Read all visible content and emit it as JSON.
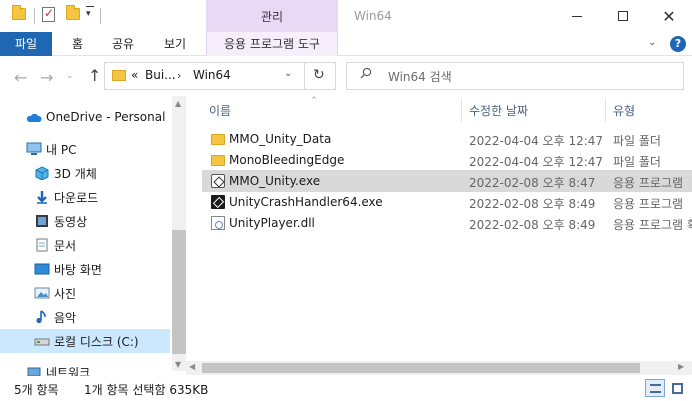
{
  "window": {
    "title": "Win64",
    "context_tab": "관리",
    "context_tools": "응용 프로그램 도구"
  },
  "ribbon": {
    "tabs": [
      "파일",
      "홈",
      "공유",
      "보기"
    ]
  },
  "address": {
    "overflow": "«",
    "crumbs": [
      "Bui...",
      "Win64"
    ]
  },
  "search": {
    "placeholder": "Win64 검색"
  },
  "sidebar": {
    "items": [
      {
        "label": "OneDrive - Personal",
        "icon": "cloud-icon"
      },
      {
        "label": "내 PC",
        "icon": "pc-icon"
      },
      {
        "label": "3D 개체",
        "icon": "3d-objects-icon"
      },
      {
        "label": "다운로드",
        "icon": "download-icon"
      },
      {
        "label": "동영상",
        "icon": "video-icon"
      },
      {
        "label": "문서",
        "icon": "document-icon"
      },
      {
        "label": "바탕 화면",
        "icon": "desktop-icon"
      },
      {
        "label": "사진",
        "icon": "picture-icon"
      },
      {
        "label": "음악",
        "icon": "music-icon"
      },
      {
        "label": "로컬 디스크 (C:)",
        "icon": "drive-icon"
      },
      {
        "label": "네트워크",
        "icon": "network-icon"
      }
    ]
  },
  "columns": {
    "name": "이름",
    "date": "수정한 날짜",
    "type": "유형"
  },
  "files": [
    {
      "name": "MMO_Unity_Data",
      "date": "2022-04-04 오후 12:47",
      "type": "파일 폴더",
      "icon": "folder-icon"
    },
    {
      "name": "MonoBleedingEdge",
      "date": "2022-04-04 오후 12:47",
      "type": "파일 폴더",
      "icon": "folder-icon"
    },
    {
      "name": "MMO_Unity.exe",
      "date": "2022-02-08 오후 8:47",
      "type": "응용 프로그램",
      "icon": "unity-app-icon"
    },
    {
      "name": "UnityCrashHandler64.exe",
      "date": "2022-02-08 오후 8:49",
      "type": "응용 프로그램",
      "icon": "crash-handler-icon"
    },
    {
      "name": "UnityPlayer.dll",
      "date": "2022-02-08 오후 8:49",
      "type": "응용 프로그램 확장",
      "icon": "dll-icon"
    }
  ],
  "status": {
    "count": "5개 항목",
    "selection": "1개 항목 선택함 635KB"
  }
}
